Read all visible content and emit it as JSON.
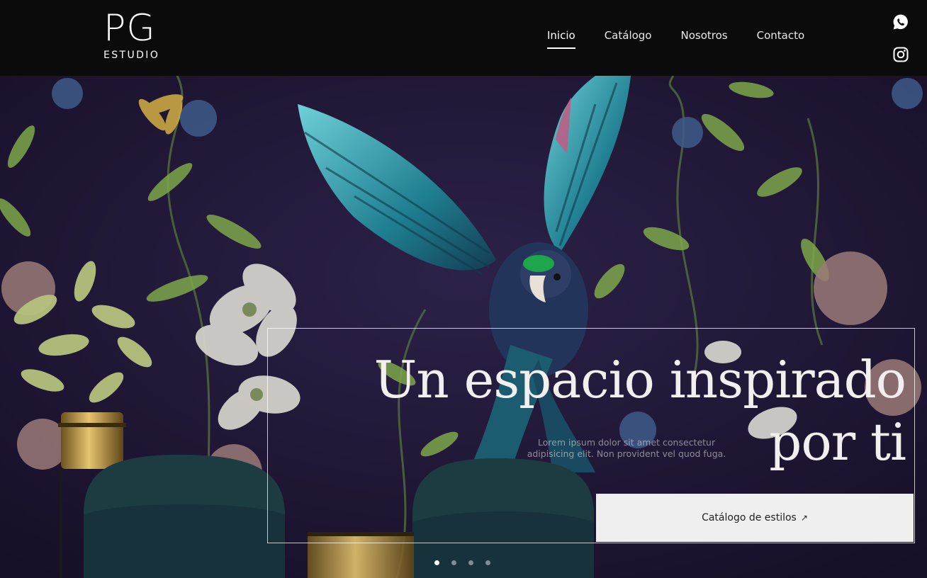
{
  "brand": {
    "mark": "PG",
    "subtitle": "ESTUDIO"
  },
  "nav": {
    "items": [
      {
        "label": "Inicio",
        "active": true
      },
      {
        "label": "Catálogo",
        "active": false
      },
      {
        "label": "Nosotros",
        "active": false
      },
      {
        "label": "Contacto",
        "active": false
      }
    ]
  },
  "social": {
    "icons": [
      "whatsapp-icon",
      "instagram-icon"
    ]
  },
  "hero": {
    "headline_line1": "Un espacio inspirado",
    "headline_line2": "por ti",
    "body": "Lorem ipsum dolor sit amet consectetur adipisicing elit. Non provident vel quod fuga.",
    "cta_label": "Catálogo de estilos",
    "cta_icon": "arrow-up-right-icon",
    "slides_total": 4,
    "slide_active": 1
  },
  "colors": {
    "header_bg": "#0b0b0b",
    "hero_bg": "#221a38",
    "cta_bg": "#efefef",
    "text_light": "#f2efee"
  }
}
